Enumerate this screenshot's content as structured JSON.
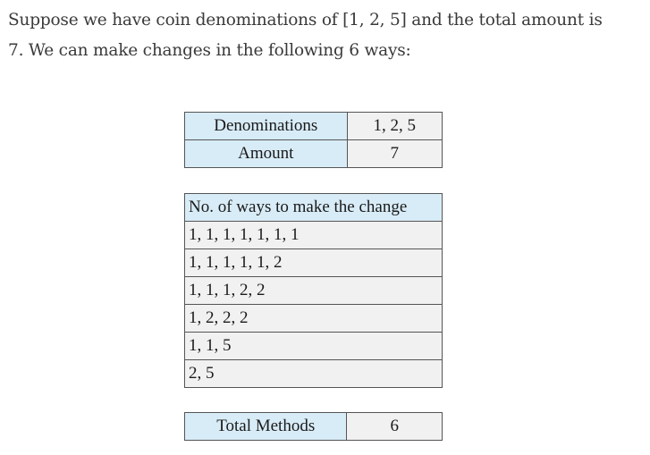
{
  "intro": {
    "line1": "Suppose we have coin denominations of [1, 2, 5] and the total amount is",
    "line2": "7. We can make changes in the following 6 ways:"
  },
  "input_table": {
    "rows": [
      {
        "label": "Denominations",
        "value": "1, 2, 5"
      },
      {
        "label": "Amount",
        "value": "7"
      }
    ]
  },
  "ways_table": {
    "header": "No. of ways to make the change",
    "rows": [
      "1, 1, 1, 1, 1, 1, 1",
      "1, 1, 1, 1, 1, 2",
      "1, 1, 1, 2, 2",
      "1, 2, 2, 2",
      "1, 1, 5",
      "2, 5"
    ]
  },
  "total_table": {
    "label": "Total Methods",
    "value": "6"
  },
  "colors": {
    "header_fill": "#d8ecf7",
    "row_fill": "#f1f1f1",
    "border": "#555555"
  }
}
